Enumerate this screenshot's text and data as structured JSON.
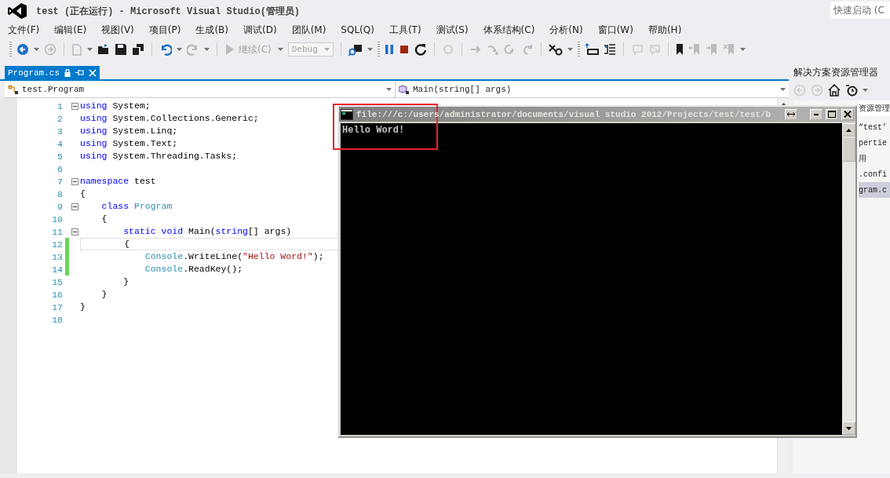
{
  "window": {
    "title": "test (正在运行) - Microsoft Visual Studio(管理员)",
    "quick_launch": {
      "placeholder": "快速启动 (C"
    }
  },
  "menu": [
    "文件(F)",
    "编辑(E)",
    "视图(V)",
    "项目(P)",
    "生成(B)",
    "调试(D)",
    "团队(M)",
    "SQL(Q)",
    "工具(T)",
    "测试(S)",
    "体系结构(C)",
    "分析(N)",
    "窗口(W)",
    "帮助(H)"
  ],
  "toolbar": {
    "continue_button": {
      "label": "继续(C)",
      "disabled": true
    },
    "config_combo": {
      "value": "Debug",
      "disabled": true
    }
  },
  "tabs": [
    {
      "label": "Program.cs",
      "selected": true
    }
  ],
  "nav_bar": {
    "type_combo": "test.Program",
    "member_combo": "Main(string[] args)"
  },
  "editor": {
    "lines": [
      {
        "number": "1",
        "fold": true,
        "changed": false,
        "current": false,
        "tokens": [
          {
            "kind": "keyword",
            "text": "using"
          },
          {
            "kind": "plain",
            "text": " System;"
          }
        ]
      },
      {
        "number": "2",
        "fold": false,
        "changed": false,
        "current": false,
        "tokens": [
          {
            "kind": "keyword",
            "text": "using"
          },
          {
            "kind": "plain",
            "text": " System.Collections.Generic;"
          }
        ]
      },
      {
        "number": "3",
        "fold": false,
        "changed": false,
        "current": false,
        "tokens": [
          {
            "kind": "keyword",
            "text": "using"
          },
          {
            "kind": "plain",
            "text": " System.Linq;"
          }
        ]
      },
      {
        "number": "4",
        "fold": false,
        "changed": false,
        "current": false,
        "tokens": [
          {
            "kind": "keyword",
            "text": "using"
          },
          {
            "kind": "plain",
            "text": " System.Text;"
          }
        ]
      },
      {
        "number": "5",
        "fold": false,
        "changed": false,
        "current": false,
        "tokens": [
          {
            "kind": "keyword",
            "text": "using"
          },
          {
            "kind": "plain",
            "text": " System.Threading.Tasks;"
          }
        ]
      },
      {
        "number": "6",
        "fold": false,
        "changed": false,
        "current": false
      },
      {
        "number": "7",
        "fold": true,
        "changed": false,
        "current": false,
        "tokens": [
          {
            "kind": "keyword",
            "text": "namespace"
          },
          {
            "kind": "plain",
            "text": " test"
          }
        ]
      },
      {
        "number": "8",
        "fold": false,
        "changed": false,
        "current": false,
        "tokens": [
          {
            "kind": "plain",
            "text": "{"
          }
        ]
      },
      {
        "number": "9",
        "fold": true,
        "changed": false,
        "current": false,
        "tokens": [
          {
            "kind": "keyword",
            "text": "    class "
          },
          {
            "kind": "type",
            "text": "Program"
          }
        ]
      },
      {
        "number": "10",
        "fold": false,
        "changed": false,
        "current": false,
        "tokens": [
          {
            "kind": "plain",
            "text": "    {"
          }
        ]
      },
      {
        "number": "11",
        "fold": true,
        "changed": false,
        "current": false,
        "tokens": [
          {
            "kind": "keyword",
            "text": "        static void"
          },
          {
            "kind": "plain",
            "text": " Main("
          },
          {
            "kind": "keyword",
            "text": "string"
          },
          {
            "kind": "plain",
            "text": "[] args)"
          }
        ]
      },
      {
        "number": "12",
        "fold": false,
        "changed": true,
        "current": true,
        "tokens": [
          {
            "kind": "plain",
            "text": "        {"
          }
        ]
      },
      {
        "number": "13",
        "fold": false,
        "changed": true,
        "current": false,
        "tokens": [
          {
            "kind": "type",
            "text": "            Console"
          },
          {
            "kind": "plain",
            "text": ".WriteLine("
          },
          {
            "kind": "string",
            "text": "\"Hello Word!\""
          },
          {
            "kind": "plain",
            "text": ");"
          }
        ]
      },
      {
        "number": "14",
        "fold": false,
        "changed": true,
        "current": false,
        "tokens": [
          {
            "kind": "type",
            "text": "            Console"
          },
          {
            "kind": "plain",
            "text": ".ReadKey();"
          }
        ]
      },
      {
        "number": "15",
        "fold": false,
        "changed": false,
        "current": false,
        "tokens": [
          {
            "kind": "plain",
            "text": "        }"
          }
        ]
      },
      {
        "number": "16",
        "fold": false,
        "changed": false,
        "current": false,
        "tokens": [
          {
            "kind": "plain",
            "text": "    }"
          }
        ]
      },
      {
        "number": "17",
        "fold": false,
        "changed": false,
        "current": false,
        "tokens": [
          {
            "kind": "plain",
            "text": "}"
          }
        ]
      },
      {
        "number": "18",
        "fold": false,
        "changed": false,
        "current": false
      }
    ]
  },
  "solution_explorer": {
    "title": "解决方案资源管理器",
    "search_text": "资源管理",
    "items": [
      {
        "label": "“test’",
        "selected": false
      },
      {
        "label": "pertie",
        "selected": false
      },
      {
        "label": "用",
        "selected": false
      },
      {
        "label": ".confi",
        "selected": false
      },
      {
        "label": "gram.c",
        "selected": true
      }
    ]
  },
  "console": {
    "title": "file:///c:/users/administrator/documents/visual studio 2012/Projects/test/test/b",
    "output": "Hello Word!"
  }
}
